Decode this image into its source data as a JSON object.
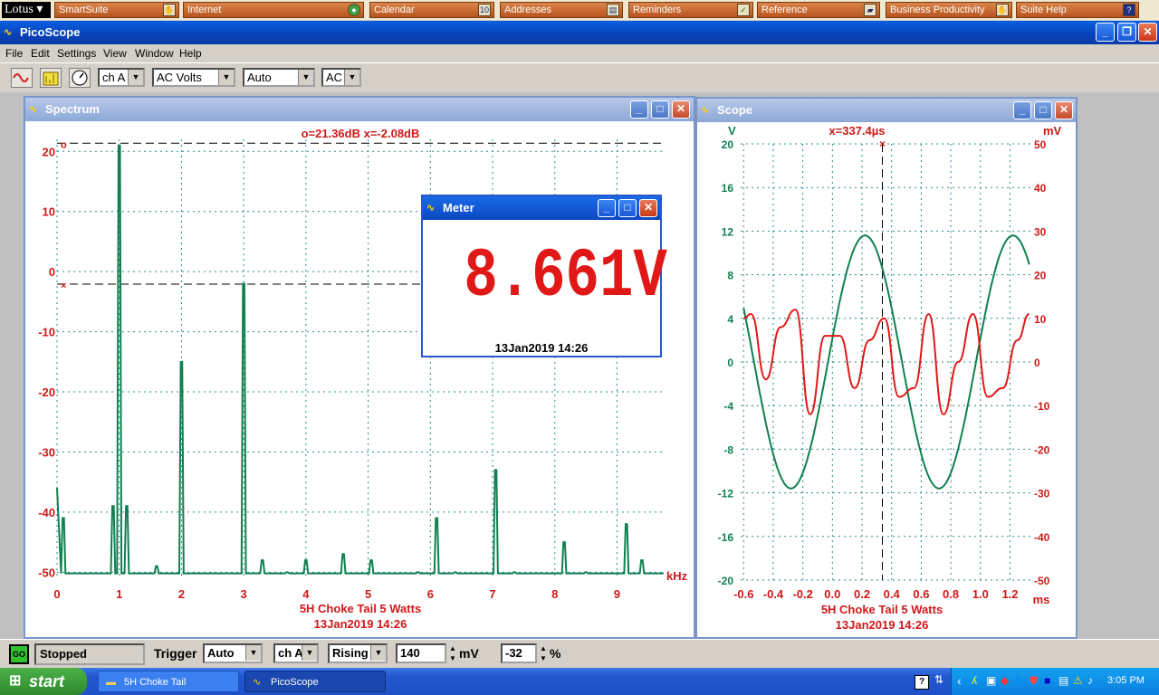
{
  "lotusbar": {
    "logo": "Lotus",
    "buttons": [
      {
        "label": "SmartSuite",
        "icon": "hand-icon"
      },
      {
        "label": "Internet",
        "icon": "globe-icon"
      },
      {
        "label": "Calendar",
        "icon": "calendar-icon"
      },
      {
        "label": "Addresses",
        "icon": "addressbook-icon"
      },
      {
        "label": "Reminders",
        "icon": "checkmark-icon"
      },
      {
        "label": "Reference",
        "icon": "book-icon"
      },
      {
        "label": "Business Productivity",
        "icon": "hand-icon"
      },
      {
        "label": "Suite Help",
        "icon": "help-icon"
      }
    ]
  },
  "app": {
    "title": "PicoScope"
  },
  "menu": [
    "File",
    "Edit",
    "Settings",
    "View",
    "Window",
    "Help"
  ],
  "toolbar": {
    "channel": "ch A",
    "mode": "AC Volts",
    "range": "Auto",
    "coupling": "AC"
  },
  "spectrum": {
    "title": "Spectrum",
    "readout": "o=21.36dB  x=-2.08dB",
    "footer_line1": "5H Choke Tail 5 Watts",
    "footer_line2": "13Jan2019  14:26",
    "xunit": "kHz"
  },
  "meter": {
    "title": "Meter",
    "value": "8.661V",
    "timestamp": "13Jan2019  14:26"
  },
  "scope": {
    "title": "Scope",
    "readout": "x=337.4µs",
    "left_unit": "V",
    "right_unit": "mV",
    "xunit": "ms",
    "footer_line1": "5H Choke Tail 5 Watts",
    "footer_line2": "13Jan2019  14:26"
  },
  "statusbar": {
    "go": "GO",
    "status": "Stopped",
    "trigger_label": "Trigger",
    "trigger_mode": "Auto",
    "trigger_channel": "ch A",
    "trigger_edge": "Rising",
    "trigger_level": "140",
    "level_unit": "mV",
    "pretrigger": "-32",
    "pretrigger_unit": "%"
  },
  "taskbar": {
    "start": "start",
    "tasks": [
      "5H Choke Tail",
      "PicoScope"
    ],
    "clock": "3:05 PM"
  },
  "chart_data": [
    {
      "type": "line",
      "name": "spectrum",
      "x_ticks": [
        "0",
        "1",
        "2",
        "3",
        "4",
        "5",
        "6",
        "7",
        "8",
        "9"
      ],
      "y_ticks": [
        "20",
        "10",
        "0",
        "-10",
        "-20",
        "-30",
        "-40",
        "-50"
      ],
      "xlim": [
        0,
        9.75
      ],
      "ylim": [
        -51,
        22
      ],
      "grid": true,
      "cursor_o_db": 21.36,
      "cursor_x_db": -2.08,
      "peaks": [
        {
          "x": 0,
          "y": -36
        },
        {
          "x": 0.1,
          "y": -41
        },
        {
          "x": 0.9,
          "y": -39
        },
        {
          "x": 1.0,
          "y": 21
        },
        {
          "x": 1.12,
          "y": -39
        },
        {
          "x": 1.6,
          "y": -49
        },
        {
          "x": 2.0,
          "y": -15
        },
        {
          "x": 3.0,
          "y": -2
        },
        {
          "x": 3.3,
          "y": -48
        },
        {
          "x": 3.7,
          "y": -50
        },
        {
          "x": 4.0,
          "y": -48
        },
        {
          "x": 4.6,
          "y": -47
        },
        {
          "x": 5.05,
          "y": -48
        },
        {
          "x": 5.8,
          "y": -50
        },
        {
          "x": 6.1,
          "y": -41
        },
        {
          "x": 6.4,
          "y": -50
        },
        {
          "x": 7.05,
          "y": -33
        },
        {
          "x": 7.35,
          "y": -50
        },
        {
          "x": 8.15,
          "y": -45
        },
        {
          "x": 8.5,
          "y": -50
        },
        {
          "x": 9.15,
          "y": -42
        },
        {
          "x": 9.4,
          "y": -48
        }
      ]
    },
    {
      "type": "line",
      "name": "scope",
      "x_ticks": [
        "-0.6",
        "-0.4",
        "-0.2",
        "0.0",
        "0.2",
        "0.4",
        "0.6",
        "0.8",
        "1.0",
        "1.2"
      ],
      "y_left_ticks": [
        "20",
        "16",
        "12",
        "8",
        "4",
        "0",
        "-4",
        "-8",
        "-12",
        "-16",
        "-20"
      ],
      "y_right_ticks": [
        "50",
        "40",
        "30",
        "20",
        "10",
        "0",
        "-10",
        "-20",
        "-30",
        "-40",
        "-50"
      ],
      "xlim": [
        -0.62,
        1.35
      ],
      "ylim_left": [
        -20,
        20
      ],
      "ylim_right": [
        -50,
        50
      ],
      "cursor_x_ms": 0.3374,
      "series": [
        {
          "color": "#108050",
          "axis": "left",
          "amplitude": 11.6,
          "frequency_khz": 1.0,
          "phase_peak_ms": 0.22
        },
        {
          "color": "#e01818",
          "axis": "right",
          "points_x": [
            -0.6,
            -0.55,
            -0.45,
            -0.35,
            -0.25,
            -0.15,
            -0.05,
            0.05,
            0.15,
            0.25,
            0.35,
            0.45,
            0.55,
            0.65,
            0.75,
            0.85,
            0.95,
            1.05,
            1.15,
            1.25,
            1.33
          ],
          "points_y": [
            10,
            11,
            -4,
            8,
            12,
            -12,
            6,
            6,
            -6,
            5,
            10,
            -8,
            -6,
            11,
            -12,
            0,
            11,
            -8,
            -6,
            5,
            11
          ]
        }
      ]
    }
  ]
}
